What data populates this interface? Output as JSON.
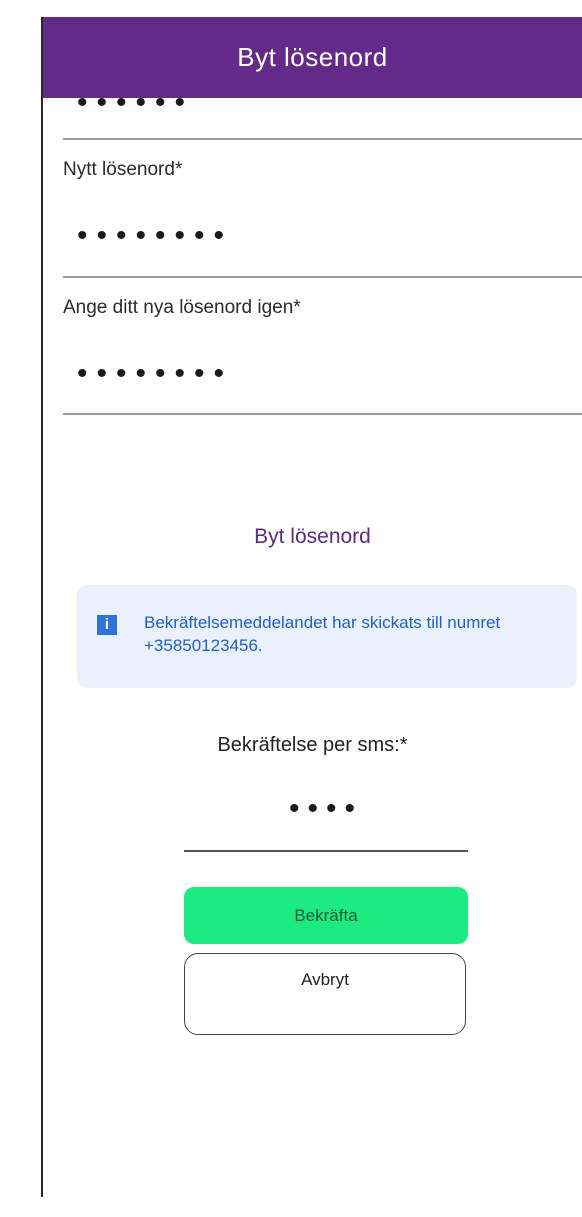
{
  "header": {
    "title": "Byt lösenord"
  },
  "form": {
    "current_password": {
      "value": "••••••"
    },
    "new_password": {
      "label": "Nytt lösenord*",
      "value": "••••••••"
    },
    "repeat_password": {
      "label": "Ange ditt nya lösenord igen*",
      "value": "••••••••"
    }
  },
  "section": {
    "title": "Byt lösenord"
  },
  "info": {
    "icon": "info-icon",
    "icon_glyph": "i",
    "text": "Bekräftelsemeddelandet har skickats till numret +35850123456."
  },
  "sms": {
    "label": "Bekräftelse per sms:*",
    "value": "••••"
  },
  "buttons": {
    "confirm": "Bekräfta",
    "cancel": "Avbryt"
  },
  "colors": {
    "header_bg": "#632a8a",
    "accent_purple": "#5a2a85",
    "confirm_green": "#1eea82",
    "info_bg": "#ebf1fc",
    "info_blue": "#2f73d8"
  }
}
